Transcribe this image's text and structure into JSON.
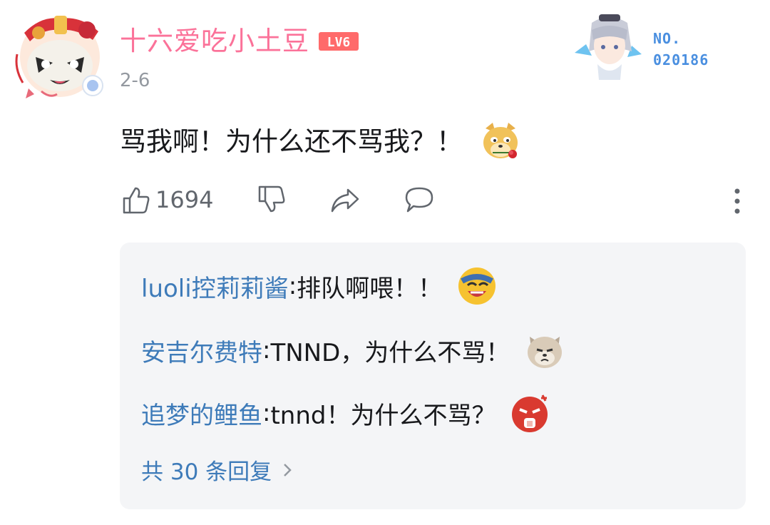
{
  "post": {
    "username": "十六爱吃小土豆",
    "level_badge": "LV6",
    "date": "2-6",
    "fan_badge": {
      "label": "NO.",
      "number": "020186"
    },
    "comment_text": "骂我啊！为什么还不骂我？！",
    "comment_emoji": "doge-rose-emoji",
    "like_count": "1694"
  },
  "replies": [
    {
      "name": "luoli控莉莉酱",
      "sep": ": ",
      "text": "排队啊喂！！",
      "emoji": "laughing-tears-emoji"
    },
    {
      "name": "安吉尔费特",
      "sep": ": ",
      "text": "TNND，为什么不骂！",
      "emoji": "shiba-dog-emoji"
    },
    {
      "name": "追梦的鲤鱼",
      "sep": ": ",
      "text": "tnnd！为什么不骂？",
      "emoji": "angry-face-emoji"
    }
  ],
  "more_replies_label": "共 30 条回复",
  "colors": {
    "username": "#fb7299",
    "level_badge": "#ff6a6a",
    "link_blue": "#3e7bb9",
    "fan_number": "#4a8fe0",
    "reply_bg": "#f4f5f7",
    "muted": "#9499a0"
  },
  "icons": [
    "like-icon",
    "dislike-icon",
    "share-icon",
    "reply-icon",
    "more-icon",
    "chevron-right-icon"
  ]
}
